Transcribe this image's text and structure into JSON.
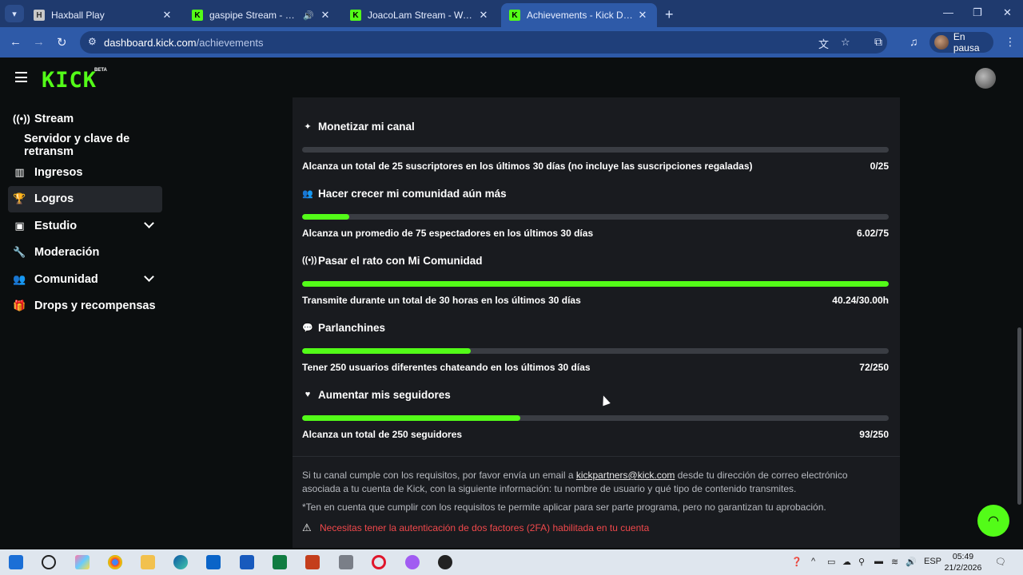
{
  "browser": {
    "tabs": [
      {
        "title": "Haxball Play",
        "favicon": "haxball-icon",
        "active": false
      },
      {
        "title": "gaspipe Stream - Watch Live",
        "favicon": "kick-icon",
        "active": false
      },
      {
        "title": "JoacoLam Stream - Watch Live",
        "favicon": "kick-icon",
        "active": false
      },
      {
        "title": "Achievements - Kick Dashboard",
        "favicon": "kick-icon",
        "active": true
      }
    ],
    "url_host": "dashboard.kick.com",
    "url_path": "/achievements",
    "profile_label": "En pausa"
  },
  "header": {
    "logo": "KICK",
    "beta": "BETA"
  },
  "sidebar": {
    "items": [
      {
        "label": "Stream",
        "icon": "broadcast-icon"
      },
      {
        "label": "Servidor y clave de retransm",
        "icon": ""
      },
      {
        "label": "Ingresos",
        "icon": "chart-icon"
      },
      {
        "label": "Logros",
        "icon": "trophy-icon"
      },
      {
        "label": "Estudio",
        "icon": "studio-icon"
      },
      {
        "label": "Moderación",
        "icon": "wrench-icon"
      },
      {
        "label": "Comunidad",
        "icon": "community-icon"
      },
      {
        "label": "Drops y recompensas",
        "icon": "gift-icon"
      }
    ]
  },
  "achievements": [
    {
      "title": "Monetizar mi canal",
      "icon": "sparkle-icon",
      "description": "Alcanza un total de 25 suscriptores en los últimos 30 días (no incluye las suscripciones regaladas)",
      "progress_text": "0/25",
      "progress": 0.0
    },
    {
      "title": "Hacer crecer mi comunidad aún más",
      "icon": "users-icon",
      "description": "Alcanza un promedio de 75 espectadores en los últimos 30 días",
      "progress_text": "6.02/75",
      "progress": 0.08
    },
    {
      "title": "Pasar el rato con Mi Comunidad",
      "icon": "broadcast-icon",
      "description": "Transmite durante un total de 30 horas en los últimos 30 días",
      "progress_text": "40.24/30.00h",
      "progress": 1.0
    },
    {
      "title": "Parlanchines",
      "icon": "chat-icon",
      "description": "Tener 250 usuarios diferentes chateando en los últimos 30 días",
      "progress_text": "72/250",
      "progress": 0.288
    },
    {
      "title": "Aumentar mis seguidores",
      "icon": "heart-icon",
      "description": "Alcanza un total de 250 seguidores",
      "progress_text": "93/250",
      "progress": 0.372
    }
  ],
  "footer": {
    "note_prefix": "Si tu canal cumple con los requisitos, por favor envía un email a ",
    "email": "kickpartners@kick.com",
    "note_suffix": " desde tu dirección de correo electrónico asociada a tu cuenta de Kick, con la siguiente información: tu nombre de usuario y qué tipo de contenido transmites.",
    "disclaimer": "*Ten en cuenta que cumplir con los requisitos te permite aplicar para ser parte programa, pero no garantizan tu aprobación.",
    "warning": "Necesitas tener la autenticación de dos factores (2FA) habilitada en tu cuenta"
  },
  "taskbar": {
    "language": "ESP",
    "time": "05:49",
    "date": "21/2/2026"
  },
  "colors": {
    "accent": "#53fc18",
    "panel": "#191b1f",
    "warning": "#f0484b"
  }
}
